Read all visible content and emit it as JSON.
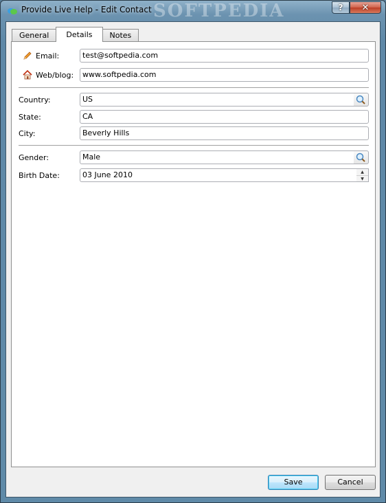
{
  "window": {
    "title": "Provide Live Help - Edit Contact",
    "watermark": "SOFTPEDIA",
    "help_label": "?",
    "close_label": "✕"
  },
  "tabs": [
    {
      "label": "General",
      "active": false
    },
    {
      "label": "Details",
      "active": true
    },
    {
      "label": "Notes",
      "active": false
    }
  ],
  "details": {
    "email": {
      "label": "Email:",
      "value": "test@softpedia.com",
      "icon": "pencil-icon"
    },
    "web": {
      "label": "Web/blog:",
      "value": "www.softpedia.com",
      "icon": "home-icon"
    },
    "country": {
      "label": "Country:",
      "value": "US"
    },
    "state": {
      "label": "State:",
      "value": "CA"
    },
    "city": {
      "label": "City:",
      "value": "Beverly Hills"
    },
    "gender": {
      "label": "Gender:",
      "value": "Male"
    },
    "birth_date": {
      "label": "Birth Date:",
      "value": "03 June 2010"
    }
  },
  "buttons": {
    "save": "Save",
    "cancel": "Cancel"
  },
  "colors": {
    "accent_border": "#3c7fb1",
    "close_red": "#bd3e26"
  }
}
